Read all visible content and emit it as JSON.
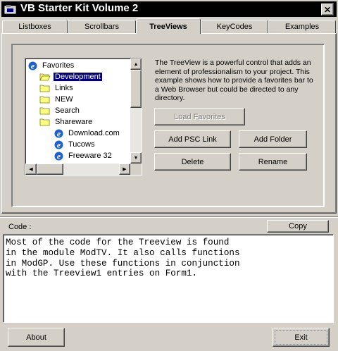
{
  "window": {
    "title": "VB Starter Kit Volume 2",
    "close_label": "✕"
  },
  "tabs": [
    {
      "label": "Listboxes",
      "active": false
    },
    {
      "label": "Scrollbars",
      "active": false
    },
    {
      "label": "TreeViews",
      "active": true
    },
    {
      "label": "KeyCodes",
      "active": false
    },
    {
      "label": "Examples",
      "active": false
    }
  ],
  "tree": {
    "items": [
      {
        "label": "Favorites",
        "icon": "ie-icon",
        "level": 0
      },
      {
        "label": "Development",
        "icon": "folder-open-icon",
        "level": 1,
        "selected": true
      },
      {
        "label": "Links",
        "icon": "folder-icon",
        "level": 1
      },
      {
        "label": "NEW",
        "icon": "folder-icon",
        "level": 1
      },
      {
        "label": "Search",
        "icon": "folder-icon",
        "level": 1
      },
      {
        "label": "Shareware",
        "icon": "folder-icon",
        "level": 1
      },
      {
        "label": "Download.com",
        "icon": "ie-icon",
        "level": 2
      },
      {
        "label": "Tucows",
        "icon": "ie-icon",
        "level": 2
      },
      {
        "label": "Freeware 32",
        "icon": "ie-icon",
        "level": 2
      }
    ]
  },
  "description": "The TreeView is a powerful control that adds an element of professionalism to your project. This example shows how to provide a favorites bar to a Web Browser but could be directed to any directory.",
  "buttons": {
    "load_favorites": "Load Favorites",
    "add_psc_link": "Add PSC Link",
    "add_folder": "Add Folder",
    "delete": "Delete",
    "rename": "Rename",
    "copy": "Copy",
    "about": "About",
    "exit": "Exit"
  },
  "code": {
    "label": "Code :",
    "text": "Most of the code for the Treeview is found\nin the module ModTV. It also calls functions\nin ModGP. Use these functions in conjunction\nwith the Treeview1 entries on Form1."
  },
  "colors": {
    "face": "#d4d0c8",
    "selection": "#000080",
    "folder": "#ffff80"
  }
}
